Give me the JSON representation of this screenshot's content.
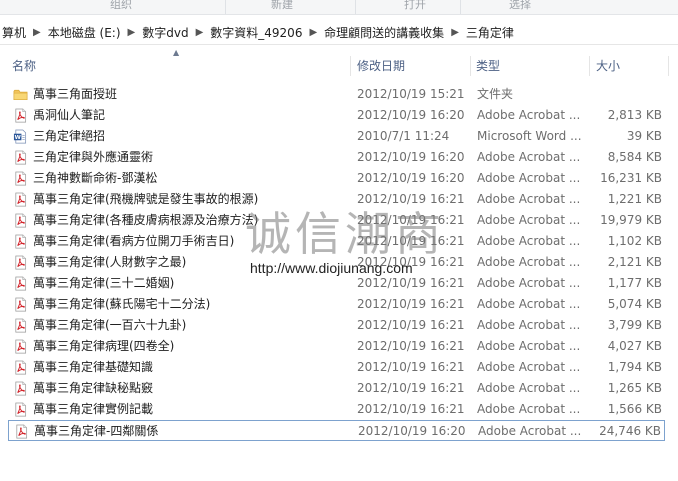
{
  "ribbon": {
    "labels": [
      "组织",
      "新建",
      "打开",
      "选择"
    ]
  },
  "address": {
    "crumbs": [
      "算机",
      "本地磁盘 (E:)",
      "數字dvd",
      "數字資料_49206",
      "命理顧問送的講義收集",
      "三角定律"
    ]
  },
  "columns": {
    "name": "名称",
    "date": "修改日期",
    "type": "类型",
    "size": "大小"
  },
  "files": [
    {
      "name": "萬事三角面授班",
      "date": "2012/10/19 15:21",
      "type": "文件夹",
      "size": "",
      "icon": "folder-icon"
    },
    {
      "name": "禹洞仙人筆記",
      "date": "2012/10/19 16:20",
      "type": "Adobe Acrobat ...",
      "size": "2,813 KB",
      "icon": "pdf-icon"
    },
    {
      "name": "三角定律絕招",
      "date": "2010/7/1 11:24",
      "type": "Microsoft Word ...",
      "size": "39 KB",
      "icon": "word-icon"
    },
    {
      "name": "三角定律與外應通靈術",
      "date": "2012/10/19 16:20",
      "type": "Adobe Acrobat ...",
      "size": "8,584 KB",
      "icon": "pdf-icon"
    },
    {
      "name": "三角神數斷命術-鄧漢松",
      "date": "2012/10/19 16:20",
      "type": "Adobe Acrobat ...",
      "size": "16,231 KB",
      "icon": "pdf-icon"
    },
    {
      "name": "萬事三角定律(飛機牌號是發生事故的根源)",
      "date": "2012/10/19 16:21",
      "type": "Adobe Acrobat ...",
      "size": "1,221 KB",
      "icon": "pdf-icon"
    },
    {
      "name": "萬事三角定律(各種皮膚病根源及治療方法)",
      "date": "2012/10/19 16:21",
      "type": "Adobe Acrobat ...",
      "size": "19,979 KB",
      "icon": "pdf-icon"
    },
    {
      "name": "萬事三角定律(看病方位開刀手術吉日)",
      "date": "2012/10/19 16:21",
      "type": "Adobe Acrobat ...",
      "size": "1,102 KB",
      "icon": "pdf-icon"
    },
    {
      "name": "萬事三角定律(人財數字之最)",
      "date": "2012/10/19 16:21",
      "type": "Adobe Acrobat ...",
      "size": "2,121 KB",
      "icon": "pdf-icon"
    },
    {
      "name": "萬事三角定律(三十二婚姻)",
      "date": "2012/10/19 16:21",
      "type": "Adobe Acrobat ...",
      "size": "1,177 KB",
      "icon": "pdf-icon"
    },
    {
      "name": "萬事三角定律(蘇氏陽宅十二分法)",
      "date": "2012/10/19 16:21",
      "type": "Adobe Acrobat ...",
      "size": "5,074 KB",
      "icon": "pdf-icon"
    },
    {
      "name": "萬事三角定律(一百六十九卦)",
      "date": "2012/10/19 16:21",
      "type": "Adobe Acrobat ...",
      "size": "3,799 KB",
      "icon": "pdf-icon"
    },
    {
      "name": "萬事三角定律病理(四卷全)",
      "date": "2012/10/19 16:21",
      "type": "Adobe Acrobat ...",
      "size": "4,027 KB",
      "icon": "pdf-icon"
    },
    {
      "name": "萬事三角定律基礎知識",
      "date": "2012/10/19 16:21",
      "type": "Adobe Acrobat ...",
      "size": "1,794 KB",
      "icon": "pdf-icon"
    },
    {
      "name": "萬事三角定律缺秘點竅",
      "date": "2012/10/19 16:21",
      "type": "Adobe Acrobat ...",
      "size": "1,265 KB",
      "icon": "pdf-icon"
    },
    {
      "name": "萬事三角定律實例記載",
      "date": "2012/10/19 16:21",
      "type": "Adobe Acrobat ...",
      "size": "1,566 KB",
      "icon": "pdf-icon"
    },
    {
      "name": "萬事三角定律-四鄰關係",
      "date": "2012/10/19 16:20",
      "type": "Adobe Acrobat ...",
      "size": "24,746 KB",
      "icon": "pdf-icon",
      "selected": true
    }
  ],
  "watermark": {
    "brand": "诚信潮商",
    "url": "http://www.diojiunang.com"
  }
}
